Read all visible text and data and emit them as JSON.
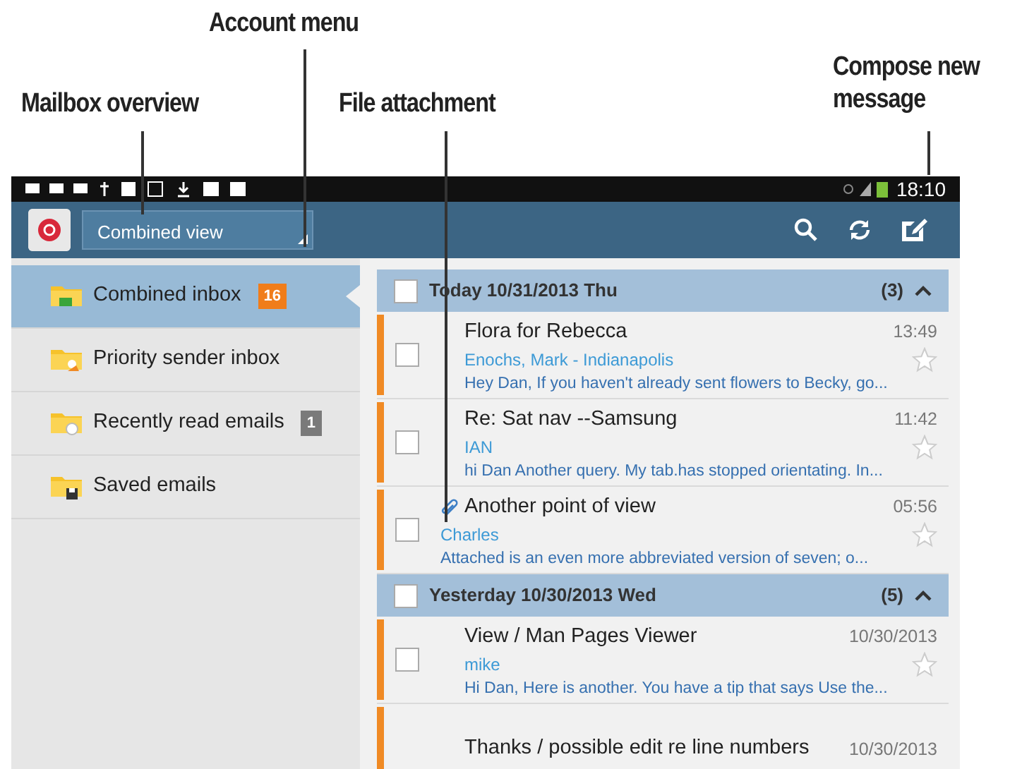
{
  "annotations": [
    {
      "text": "Account menu"
    },
    {
      "text": "Mailbox overview"
    },
    {
      "text": "File attachment"
    },
    {
      "text": "Compose new message"
    }
  ],
  "status_bar": {
    "time": "18:10"
  },
  "action_bar": {
    "account": "Combined view"
  },
  "mailboxes": [
    {
      "label": "Combined inbox",
      "badge": "16",
      "color": "#f07d1a",
      "selected": true
    },
    {
      "label": "Priority sender inbox",
      "selected": false
    },
    {
      "label": "Recently read emails",
      "badge": "1",
      "color": "#7a7a7a",
      "selected": false
    },
    {
      "label": "Saved emails",
      "selected": false
    }
  ],
  "groups": [
    {
      "title": "Today  10/31/2013 Thu",
      "count": "(3)",
      "checked": false,
      "expanded": true,
      "messages": [
        {
          "subject": "Flora for Rebecca",
          "time": "13:49",
          "sender": "Enochs, Mark - Indianapolis",
          "preview": "Hey Dan, If you haven't already sent flowers to Becky, go...",
          "attachment": false,
          "starred": false,
          "unread": true,
          "checked": false
        },
        {
          "subject": "Re: Sat nav --Samsung",
          "time": "11:42",
          "sender": "IAN",
          "preview": "hi Dan Another query. My tab.has stopped orientating. In...",
          "attachment": false,
          "starred": false,
          "unread": true,
          "checked": false
        },
        {
          "subject": "Another point of view",
          "time": "05:56",
          "sender": "Charles",
          "preview": "Attached is an even more abbreviated version of seven; o...",
          "attachment": true,
          "starred": false,
          "unread": true,
          "checked": false
        }
      ]
    },
    {
      "title": "Yesterday  10/30/2013 Wed",
      "count": "(5)",
      "checked": false,
      "expanded": true,
      "messages": [
        {
          "subject": "View / Man Pages Viewer",
          "time": "10/30/2013",
          "sender": "mike",
          "preview": "Hi Dan, Here is another. You have a tip that says Use the...",
          "attachment": false,
          "starred": false,
          "unread": true,
          "checked": false
        },
        {
          "subject": "Thanks / possible edit re line numbers",
          "time": "10/30/2013",
          "attachment": false,
          "unread": true
        }
      ]
    }
  ]
}
